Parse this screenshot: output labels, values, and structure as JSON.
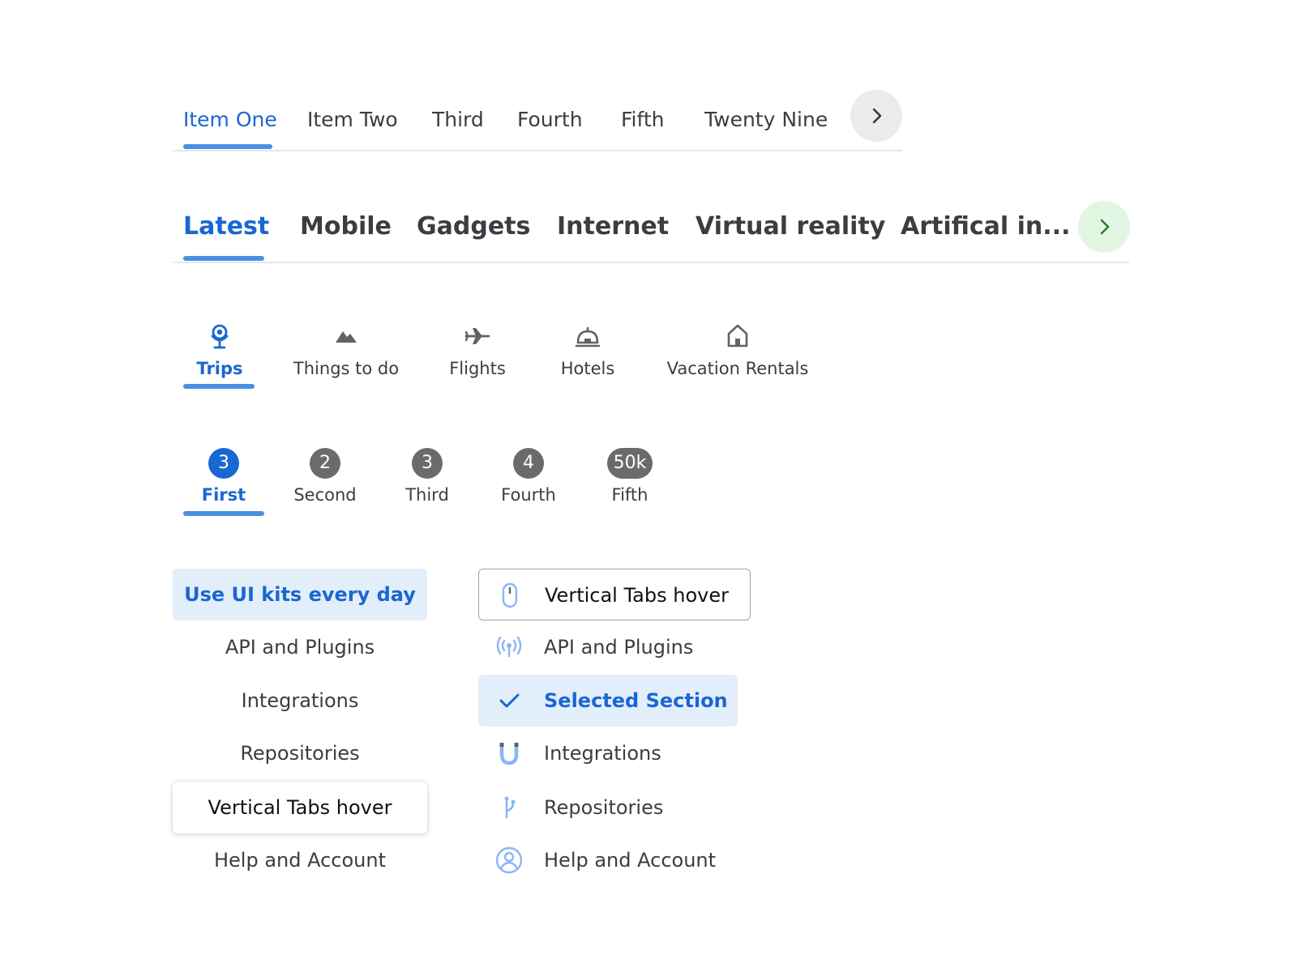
{
  "colors": {
    "accent": "#1967d2",
    "indicator": "#4a90e2",
    "tab_text": "#3c3c43",
    "badge_inactive": "#6b6b6b",
    "selected_bg": "#e3eefb",
    "scroll_grey_bg": "#ebebeb",
    "scroll_green_bg": "#e2f6e4",
    "scroll_green_icon": "#2e7d32"
  },
  "tabs_small": {
    "items": [
      {
        "label": "Item One",
        "active": true
      },
      {
        "label": "Item Two"
      },
      {
        "label": "Third"
      },
      {
        "label": "Fourth"
      },
      {
        "label": "Fifth"
      },
      {
        "label": "Twenty Nine"
      }
    ],
    "scroll_icon": "chevron-right-icon"
  },
  "tabs_large": {
    "items": [
      {
        "label": "Latest",
        "active": true
      },
      {
        "label": "Mobile"
      },
      {
        "label": "Gadgets"
      },
      {
        "label": "Internet"
      },
      {
        "label": "Virtual reality"
      },
      {
        "label": "Artifical in..."
      }
    ],
    "scroll_icon": "chevron-right-icon"
  },
  "tabs_icons": {
    "items": [
      {
        "label": "Trips",
        "icon": "globe-stand-icon",
        "active": true
      },
      {
        "label": "Things to do",
        "icon": "mountain-icon"
      },
      {
        "label": "Flights",
        "icon": "airplane-icon"
      },
      {
        "label": "Hotels",
        "icon": "hotel-bell-icon"
      },
      {
        "label": "Vacation Rentals",
        "icon": "home-icon"
      }
    ]
  },
  "tabs_badges": {
    "items": [
      {
        "label": "First",
        "badge": "3",
        "active": true
      },
      {
        "label": "Second",
        "badge": "2"
      },
      {
        "label": "Third",
        "badge": "3"
      },
      {
        "label": "Fourth",
        "badge": "4"
      },
      {
        "label": "Fifth",
        "badge": "50k"
      }
    ]
  },
  "vertical_left": {
    "items": [
      {
        "label": "Use UI kits every day",
        "state": "selected"
      },
      {
        "label": "API and Plugins"
      },
      {
        "label": "Integrations"
      },
      {
        "label": "Repositories"
      },
      {
        "label": "Vertical Tabs hover",
        "state": "hover"
      },
      {
        "label": "Help and Account"
      }
    ]
  },
  "vertical_right": {
    "items": [
      {
        "label": "Vertical Tabs hover",
        "icon": "mouse-icon",
        "state": "hover"
      },
      {
        "label": "API and Plugins",
        "icon": "broadcast-icon"
      },
      {
        "label": "Selected Section",
        "icon": "check-icon",
        "state": "selected"
      },
      {
        "label": "Integrations",
        "icon": "magnet-icon"
      },
      {
        "label": "Repositories",
        "icon": "branch-icon"
      },
      {
        "label": "Help and Account",
        "icon": "user-circle-icon"
      }
    ]
  }
}
